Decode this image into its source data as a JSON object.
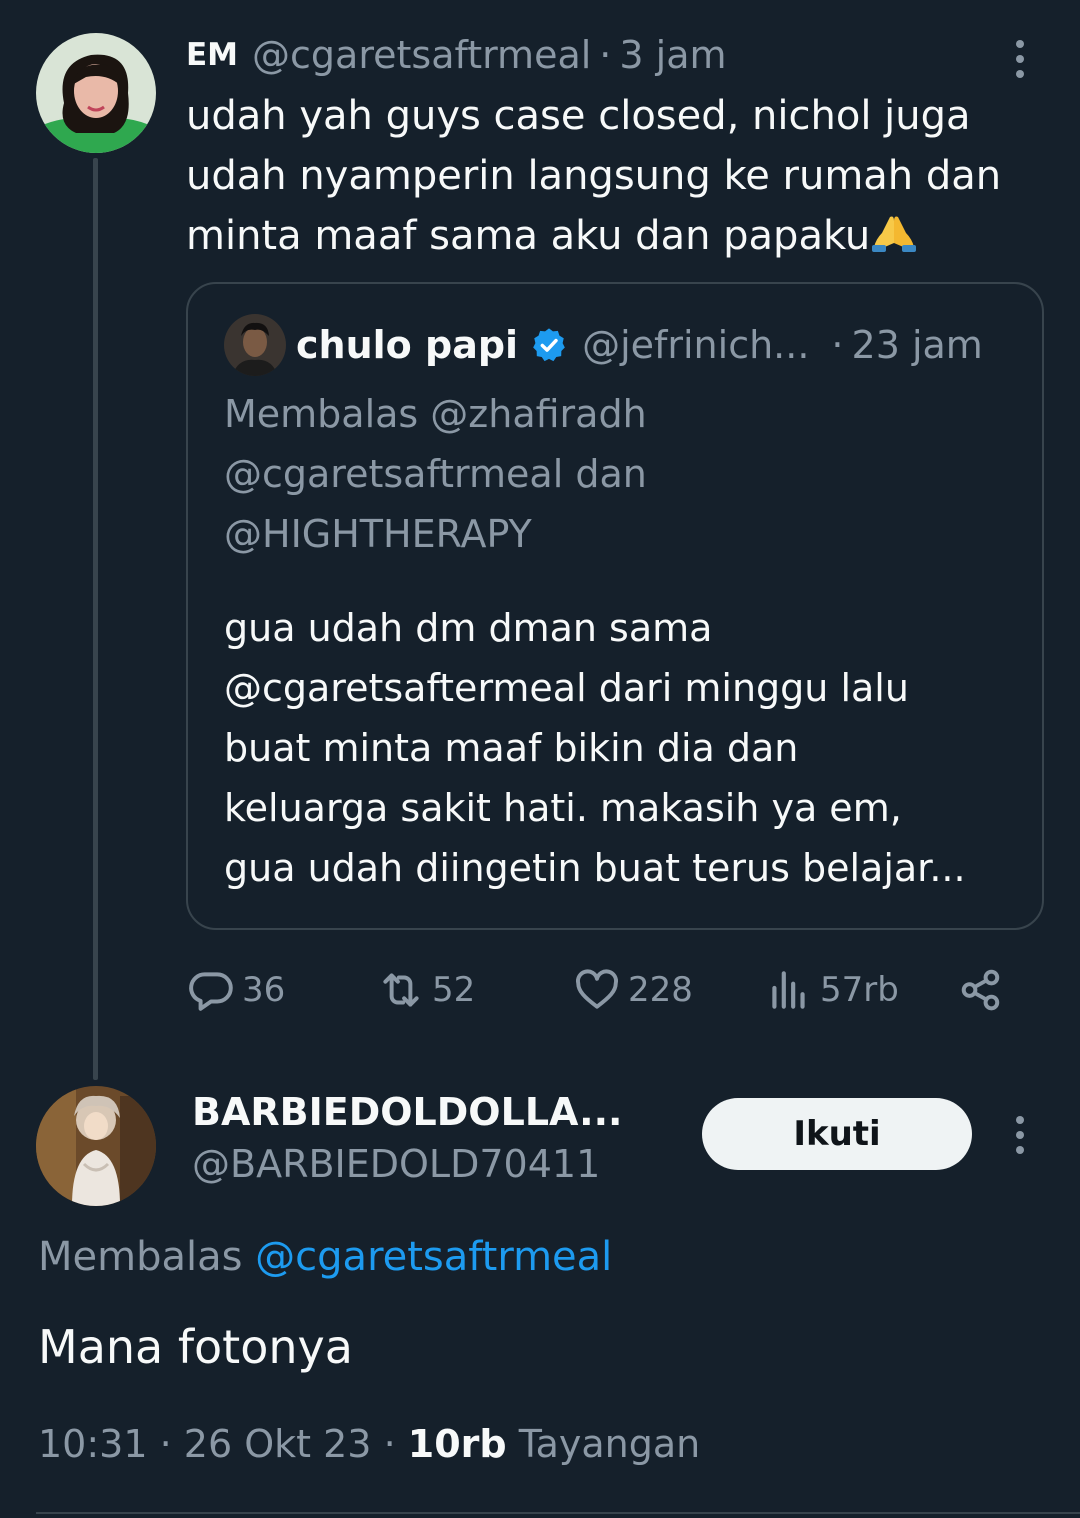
{
  "tweet": {
    "author_name": "EM",
    "handle": "@cgaretsaftrmeal",
    "separator": "·",
    "time": "3 jam",
    "text_lines": [
      "udah yah guys case closed, nichol juga",
      "udah nyamperin langsung ke rumah dan",
      "minta maaf sama aku dan papaku"
    ],
    "emoji": "folded-hands",
    "quote": {
      "author_name": "chulo papi",
      "verified": true,
      "handle": "@jefrinich...",
      "separator": "·",
      "time": "23 jam",
      "reply_lines": [
        "Membalas @zhafiradh",
        "@cgaretsaftrmeal dan",
        "@HIGHTHERAPY"
      ],
      "text_lines": [
        "gua udah dm dman sama",
        "@cgaretsaftermeal dari minggu lalu",
        "buat minta maaf bikin dia dan",
        "keluarga sakit hati. makasih ya em,",
        "gua udah diingetin buat terus belajar..."
      ]
    },
    "actions": {
      "replies": "36",
      "retweets": "52",
      "likes": "228",
      "views": "57rb"
    }
  },
  "reply": {
    "author_name": "BARBIEDOLDOLLA...",
    "handle": "@BARBIEDOLD70411",
    "follow_label": "Ikuti",
    "replying_prefix": "Membalas",
    "replying_to": "@cgaretsaftrmeal",
    "text": "Mana fotonya",
    "time": "10:31",
    "separator": "·",
    "date": "26 Okt 23",
    "views_count": "10rb",
    "views_label": "Tayangan"
  },
  "colors": {
    "background": "#15202b",
    "text_primary": "#f7f9f9",
    "text_secondary": "#8b98a5",
    "accent": "#1d9bf0",
    "border": "#38444d"
  }
}
